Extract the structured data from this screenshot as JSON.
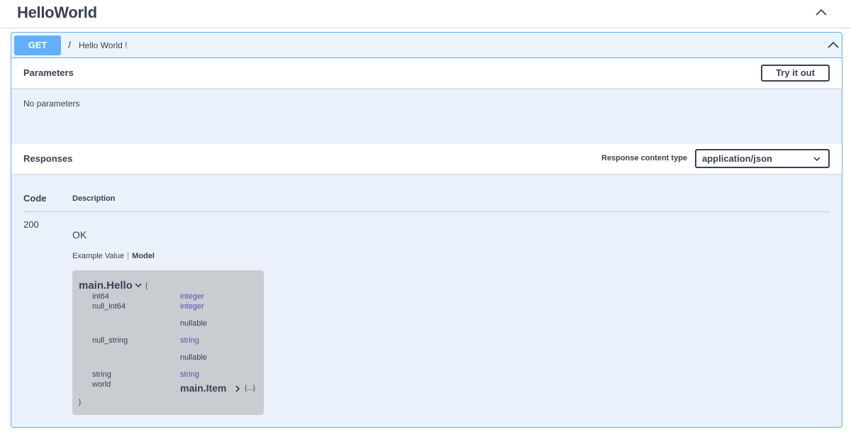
{
  "section": {
    "title": "HelloWorld",
    "toggle_icon": "chevron-up-icon"
  },
  "operation": {
    "method": "GET",
    "path": "/",
    "summary": "Hello World !",
    "toggle_icon": "chevron-up-icon",
    "method_color": "#61affe"
  },
  "parameters": {
    "title": "Parameters",
    "try_button": "Try it out",
    "empty_text": "No parameters"
  },
  "responses": {
    "title": "Responses",
    "content_type_label": "Response content type",
    "content_type_value": "application/json",
    "header_code": "Code",
    "header_description": "Description",
    "rows": [
      {
        "code": "200",
        "description": "OK",
        "tabs": {
          "example": "Example Value",
          "model": "Model"
        },
        "model": {
          "name": "main.Hello",
          "open_brace": "{",
          "close_brace": "}",
          "properties": [
            {
              "name": "int64",
              "type": "integer"
            },
            {
              "name": "null_int64",
              "type": "integer",
              "meta": "nullable"
            },
            {
              "name": "null_string",
              "type": "string",
              "meta": "nullable"
            },
            {
              "name": "string",
              "type": "string"
            },
            {
              "name": "world",
              "ref": "main.Item",
              "collapsed": "{...}"
            }
          ]
        }
      }
    ]
  }
}
